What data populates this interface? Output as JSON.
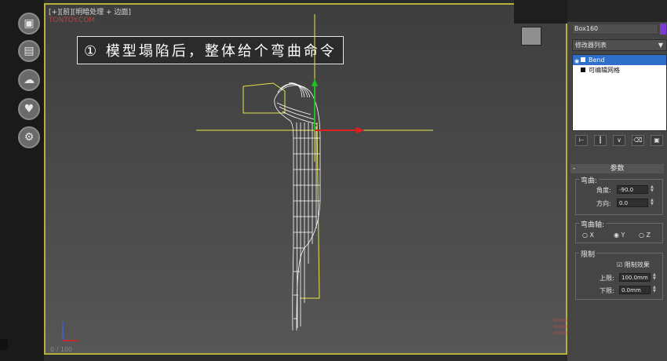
{
  "viewport": {
    "label": "[+][前][明暗处理 + 边面]",
    "watermark": "TONTOY.COM",
    "caption": "① 模型塌陷后，整体给个弯曲命令",
    "frame_counter": "0 / 100"
  },
  "sidebar_icons": [
    "cube-icon",
    "document-icon",
    "cloud-icon",
    "heart-icon",
    "gear-icon"
  ],
  "panel": {
    "object_name": "Box160",
    "modifier_list": "修改器列表",
    "stack": [
      {
        "label": "Bend",
        "selected": true
      },
      {
        "label": "可编辑网格",
        "selected": false
      }
    ],
    "params_title": "参数",
    "bend_group": "弯曲:",
    "angle_label": "角度:",
    "angle_value": "-90.0",
    "direction_label": "方向:",
    "direction_value": "0.0",
    "axis_group": "弯曲轴:",
    "axis_options": [
      "X",
      "Y",
      "Z"
    ],
    "axis_selected": "Y",
    "limits_group": "限制",
    "limit_effect": "限制效果",
    "upper_label": "上限:",
    "upper_value": "100.0mm",
    "lower_label": "下限:",
    "lower_value": "0.0mm"
  },
  "colors": {
    "viewport_border": "#b4b03c",
    "wire": "#ffffff",
    "gizmo_yellow": "#e8e44a",
    "axis_red": "#e02020",
    "axis_green": "#20c020",
    "selection_blue": "#2f6fc9"
  }
}
